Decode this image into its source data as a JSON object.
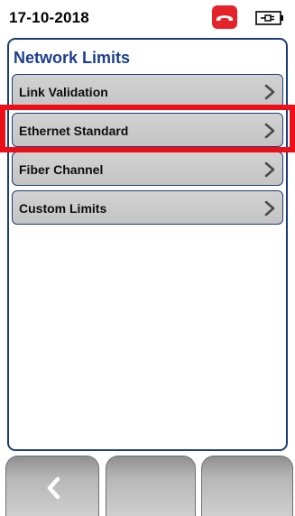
{
  "status": {
    "date": "17-10-2018",
    "icons": [
      "phone-hangup-icon",
      "battery-plug-icon"
    ]
  },
  "panel": {
    "title": "Network Limits",
    "items": [
      {
        "label": "Link Validation",
        "icon": "chevron-right-icon"
      },
      {
        "label": "Ethernet Standard",
        "icon": "chevron-right-icon",
        "highlighted": true
      },
      {
        "label": "Fiber Channel",
        "icon": "chevron-right-icon"
      },
      {
        "label": "Custom Limits",
        "icon": "chevron-right-icon"
      }
    ]
  },
  "softkeys": [
    {
      "icon": "back-arrow-icon"
    },
    {
      "icon": ""
    },
    {
      "icon": ""
    }
  ],
  "colors": {
    "accent": "#1c3f8f",
    "highlight": "#ec0f17",
    "phone": "#e52229",
    "item_bg": "#c8c8c8"
  }
}
